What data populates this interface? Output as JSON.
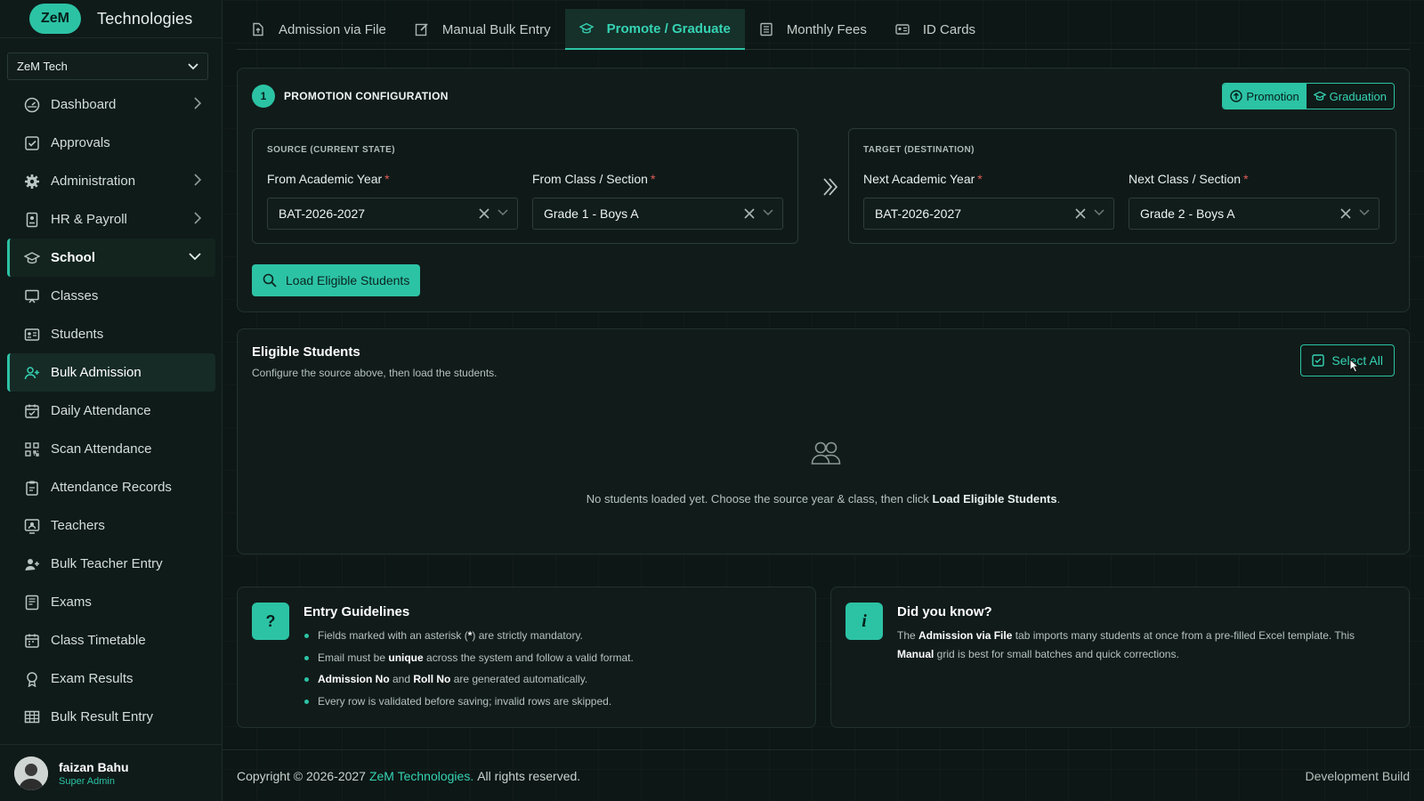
{
  "brand": {
    "logo": "ZeM",
    "name": "Technologies"
  },
  "org_select": {
    "value": "ZeM Tech"
  },
  "nav": [
    {
      "label": "Dashboard",
      "icon": "dashboard-icon",
      "arrow": true
    },
    {
      "label": "Approvals",
      "icon": "approval-icon"
    },
    {
      "label": "Administration",
      "icon": "gear-icon",
      "arrow": true
    },
    {
      "label": "HR & Payroll",
      "icon": "id-badge-icon",
      "arrow": true
    },
    {
      "label": "School",
      "icon": "graduation-cap-icon",
      "open": true
    },
    {
      "label": "Classes",
      "icon": "classroom-icon"
    },
    {
      "label": "Students",
      "icon": "student-card-icon"
    },
    {
      "label": "Bulk Admission",
      "icon": "user-plus-icon",
      "active": true
    },
    {
      "label": "Daily Attendance",
      "icon": "calendar-check-icon"
    },
    {
      "label": "Scan Attendance",
      "icon": "qr-scan-icon"
    },
    {
      "label": "Attendance Records",
      "icon": "clipboard-icon"
    },
    {
      "label": "Teachers",
      "icon": "teacher-icon"
    },
    {
      "label": "Bulk Teacher Entry",
      "icon": "user-plus-icon"
    },
    {
      "label": "Exams",
      "icon": "exam-icon"
    },
    {
      "label": "Class Timetable",
      "icon": "timetable-icon"
    },
    {
      "label": "Exam Results",
      "icon": "award-icon"
    },
    {
      "label": "Bulk Result Entry",
      "icon": "grid-icon"
    }
  ],
  "user": {
    "name": "faizan Bahu",
    "role": "Super Admin"
  },
  "tabs": [
    {
      "label": "Admission via File",
      "icon": "file-upload-icon"
    },
    {
      "label": "Manual Bulk Entry",
      "icon": "edit-icon"
    },
    {
      "label": "Promote / Graduate",
      "icon": "graduation-cap-icon",
      "active": true
    },
    {
      "label": "Monthly Fees",
      "icon": "receipt-icon"
    },
    {
      "label": "ID Cards",
      "icon": "id-card-icon"
    }
  ],
  "config": {
    "step": "1",
    "title": "PROMOTION CONFIGURATION",
    "mode_promotion": "Promotion",
    "mode_graduation": "Graduation",
    "source": {
      "title": "SOURCE (CURRENT STATE)",
      "year_label": "From Academic Year",
      "year_value": "BAT-2026-2027",
      "class_label": "From Class / Section",
      "class_value": "Grade 1 - Boys A"
    },
    "target": {
      "title": "TARGET (DESTINATION)",
      "year_label": "Next Academic Year",
      "year_value": "BAT-2026-2027",
      "class_label": "Next Class / Section",
      "class_value": "Grade 2 - Boys A"
    },
    "required_mark": "*",
    "load_button": "Load Eligible Students"
  },
  "eligible": {
    "title": "Eligible Students",
    "subtitle": "Configure the source above, then load the students.",
    "select_all": "Select All",
    "empty_pre": "No students loaded yet. Choose the source year & class, then click ",
    "empty_link": "Load Eligible Students",
    "empty_post": "."
  },
  "guidelines": {
    "badge": "?",
    "title": "Entry Guidelines",
    "items": [
      {
        "pre": "Fields marked with an asterisk (",
        "bold": "*",
        "post": ") are strictly mandatory."
      },
      {
        "pre": "Email must be ",
        "bold": "unique",
        "post": " across the system and follow a valid format."
      },
      {
        "pre": "",
        "bold": "Admission No",
        "mid": " and ",
        "bold2": "Roll No",
        "post": " are generated automatically."
      },
      {
        "pre": "Every row is validated before saving; invalid rows are skipped.",
        "bold": "",
        "post": ""
      }
    ]
  },
  "did_you_know": {
    "badge": "i",
    "title": "Did you know?",
    "p1": "The ",
    "b1": "Admission via File",
    "p2": " tab imports many students at once from a pre-filled Excel template. This ",
    "b2": "Manual",
    "p3": " grid is best for small batches and quick corrections."
  },
  "footer": {
    "copyright": "Copyright © 2026-2027",
    "brand": "ZeM Technologies.",
    "rights": "All rights reserved.",
    "build": "Development Build"
  },
  "colors": {
    "accent": "#2cc3a5",
    "background": "#0d1715",
    "required": "#e05a5a"
  }
}
